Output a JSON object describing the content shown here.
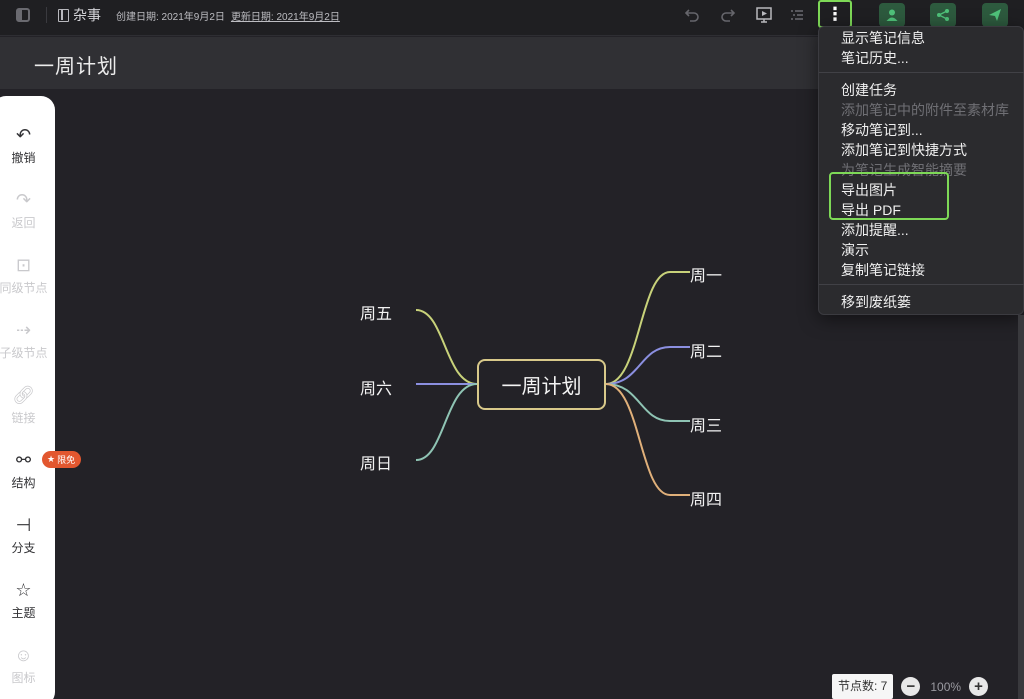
{
  "topbar": {
    "notebook": "杂事",
    "created": "创建日期: 2021年9月2日",
    "updated": "更新日期: 2021年9月2日",
    "more_icon": "⋮"
  },
  "note": {
    "title": "一周计划"
  },
  "toolbar": {
    "items": [
      {
        "label": "撤销",
        "icon": "undo-icon",
        "enabled": true
      },
      {
        "label": "返回",
        "icon": "redo-icon",
        "enabled": false
      },
      {
        "label": "同级节点",
        "icon": "sibling-node-icon",
        "enabled": false
      },
      {
        "label": "子级节点",
        "icon": "child-node-icon",
        "enabled": false
      },
      {
        "label": "链接",
        "icon": "link-icon",
        "enabled": false
      },
      {
        "label": "结构",
        "icon": "structure-icon",
        "enabled": true
      },
      {
        "label": "分支",
        "icon": "branch-icon",
        "enabled": true
      },
      {
        "label": "主题",
        "icon": "theme-icon",
        "enabled": true
      },
      {
        "label": "图标",
        "icon": "sticker-icon",
        "enabled": false
      }
    ],
    "badge": "限免"
  },
  "mindmap": {
    "center": "一周计划",
    "right": [
      "周一",
      "周二",
      "周三",
      "周四"
    ],
    "left": [
      "周五",
      "周六",
      "周日"
    ],
    "colors": {
      "mon": "#c8d27a",
      "tue": "#8b8fe0",
      "wed": "#8fc4b4",
      "thu": "#e0b07a",
      "fri": "#c8d27a",
      "sat": "#8b8fe0",
      "sun": "#8fc4b4",
      "center_border": "#d8c98a"
    }
  },
  "menu": {
    "items": [
      {
        "label": "显示笔记信息",
        "enabled": true
      },
      {
        "label": "笔记历史...",
        "enabled": true
      },
      {
        "label": "创建任务",
        "enabled": true
      },
      {
        "label": "添加笔记中的附件至素材库",
        "enabled": false
      },
      {
        "label": "移动笔记到...",
        "enabled": true
      },
      {
        "label": "添加笔记到快捷方式",
        "enabled": true
      },
      {
        "label": "为笔记生成智能摘要",
        "enabled": false
      },
      {
        "label": "导出图片",
        "enabled": true
      },
      {
        "label": "导出 PDF",
        "enabled": true
      },
      {
        "label": "添加提醒...",
        "enabled": true
      },
      {
        "label": "演示",
        "enabled": true
      },
      {
        "label": "复制笔记链接",
        "enabled": true
      },
      {
        "label": "移到废纸篓",
        "enabled": true
      }
    ]
  },
  "status": {
    "node_count": "节点数: 7",
    "zoom": "100%",
    "zoom_out": "−",
    "zoom_in": "+"
  },
  "colors": {
    "accent_highlight": "#7ed957",
    "share_green": "#2d5a3e",
    "badge": "#e2572f"
  }
}
